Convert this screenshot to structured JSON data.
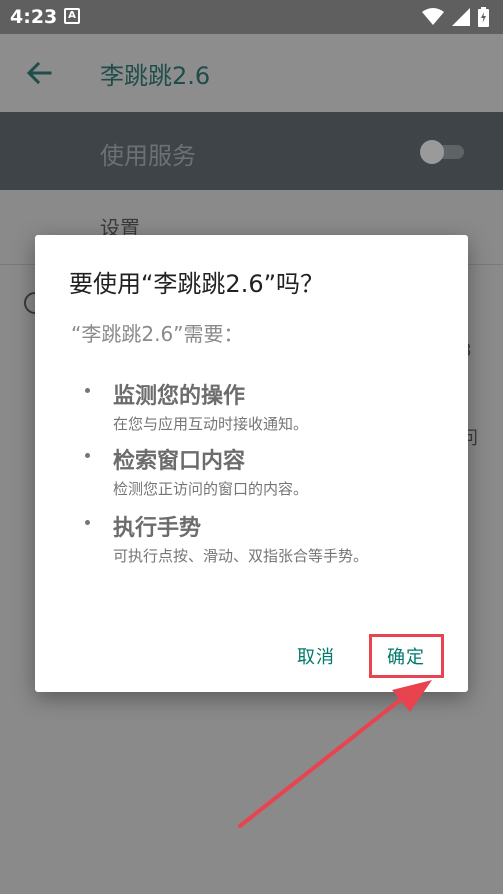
{
  "status_bar": {
    "time": "4:23",
    "notif_icon_letter": "A"
  },
  "toolbar": {
    "title": "李跳跳2.6"
  },
  "background": {
    "service_label": "使用服务",
    "settings_label": "设置",
    "edge_text_1": "8",
    "edge_text_2": "问"
  },
  "dialog": {
    "title": "要使用“李跳跳2.6”吗？",
    "subtitle": "“李跳跳2.6”需要：",
    "capabilities": [
      {
        "name": "监测您的操作",
        "desc": "在您与应用互动时接收通知。"
      },
      {
        "name": "检索窗口内容",
        "desc": "检测您正访问的窗口的内容。"
      },
      {
        "name": "执行手势",
        "desc": "可执行点按、滑动、双指张合等手势。"
      }
    ],
    "cancel_label": "取消",
    "ok_label": "确定"
  },
  "colors": {
    "accent": "#00796b",
    "highlight": "#e8434e",
    "scrim": "#8a8a8a"
  }
}
